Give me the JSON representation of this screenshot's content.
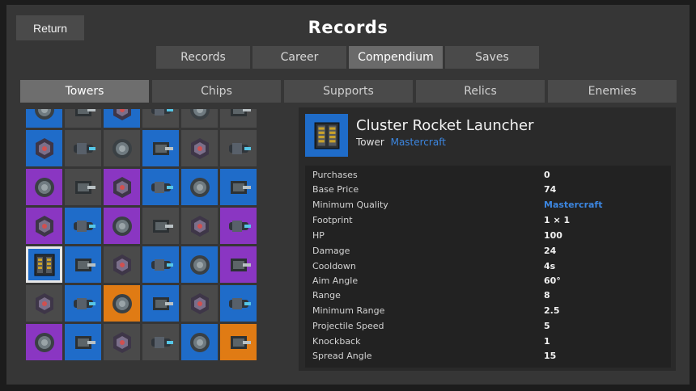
{
  "header": {
    "return_label": "Return",
    "title": "Records"
  },
  "top_tabs": [
    {
      "label": "Records",
      "active": false
    },
    {
      "label": "Career",
      "active": false
    },
    {
      "label": "Compendium",
      "active": true
    },
    {
      "label": "Saves",
      "active": false
    }
  ],
  "category_tabs": [
    {
      "label": "Towers",
      "active": true
    },
    {
      "label": "Chips",
      "active": false
    },
    {
      "label": "Supports",
      "active": false
    },
    {
      "label": "Relics",
      "active": false
    },
    {
      "label": "Enemies",
      "active": false
    }
  ],
  "grid": {
    "cells": [
      {
        "color": "blue",
        "icon": "tower-turret-icon"
      },
      {
        "color": "gray",
        "icon": "tower-turret-icon"
      },
      {
        "color": "blue",
        "icon": "tower-turret-icon"
      },
      {
        "color": "gray",
        "icon": "tower-turret-icon"
      },
      {
        "color": "gray",
        "icon": "tower-turret-icon"
      },
      {
        "color": "gray",
        "icon": "tower-turret-icon"
      },
      {
        "color": "blue",
        "icon": "ring-cannon-icon"
      },
      {
        "color": "gray",
        "icon": "capsule-tower-icon"
      },
      {
        "color": "gray",
        "icon": "long-barrel-icon"
      },
      {
        "color": "blue",
        "icon": "tank-turret-icon"
      },
      {
        "color": "gray",
        "icon": "octagon-gear-icon"
      },
      {
        "color": "gray",
        "icon": "green-launcher-icon"
      },
      {
        "color": "purple",
        "icon": "crab-turret-icon"
      },
      {
        "color": "gray",
        "icon": "white-orb-icon"
      },
      {
        "color": "purple",
        "icon": "heavy-cannon-icon"
      },
      {
        "color": "blue",
        "icon": "sun-core-icon"
      },
      {
        "color": "blue",
        "icon": "red-laser-icon"
      },
      {
        "color": "blue",
        "icon": "blue-dome-icon"
      },
      {
        "color": "purple",
        "icon": "magenta-core-icon"
      },
      {
        "color": "blue",
        "icon": "twin-barrel-icon"
      },
      {
        "color": "purple",
        "icon": "missile-pod-icon"
      },
      {
        "color": "gray",
        "icon": "octagon-plate-icon"
      },
      {
        "color": "gray",
        "icon": "green-jet-icon"
      },
      {
        "color": "purple",
        "icon": "blue-beetle-icon"
      },
      {
        "color": "blue",
        "icon": "cluster-rocket-launcher-icon",
        "selected": true
      },
      {
        "color": "blue",
        "icon": "drill-tower-icon"
      },
      {
        "color": "gray",
        "icon": "box-turret-icon"
      },
      {
        "color": "blue",
        "icon": "rail-gun-icon"
      },
      {
        "color": "blue",
        "icon": "cross-core-icon"
      },
      {
        "color": "purple",
        "icon": "star-ring-icon"
      },
      {
        "color": "gray",
        "icon": "armored-tank-icon"
      },
      {
        "color": "blue",
        "icon": "emerald-core-icon"
      },
      {
        "color": "orange",
        "icon": "violet-core-icon"
      },
      {
        "color": "blue",
        "icon": "red-mech-icon"
      },
      {
        "color": "gray",
        "icon": "small-block-icon"
      },
      {
        "color": "blue",
        "icon": "orange-turret-icon"
      },
      {
        "color": "purple",
        "icon": "cannon-sled-icon"
      },
      {
        "color": "blue",
        "icon": "cargo-tower-icon"
      },
      {
        "color": "gray",
        "icon": "column-tower-icon"
      },
      {
        "color": "gray",
        "icon": "green-gun-icon"
      },
      {
        "color": "blue",
        "icon": "red-sphere-icon"
      },
      {
        "color": "orange",
        "icon": "stone-octagon-icon"
      }
    ]
  },
  "detail": {
    "icon": "cluster-rocket-launcher-icon",
    "name": "Cluster Rocket Launcher",
    "kind": "Tower",
    "quality": "Mastercraft",
    "stats": [
      {
        "label": "Purchases",
        "value": "0"
      },
      {
        "label": "Base Price",
        "value": "74"
      },
      {
        "label": "Minimum Quality",
        "value": "Mastercraft",
        "quality": true
      },
      {
        "label": "Footprint",
        "value": "1 × 1"
      },
      {
        "label": "HP",
        "value": "100"
      },
      {
        "label": "Damage",
        "value": "24"
      },
      {
        "label": "Cooldown",
        "value": "4s"
      },
      {
        "label": "Aim Angle",
        "value": "60°"
      },
      {
        "label": "Range",
        "value": "8"
      },
      {
        "label": "Minimum Range",
        "value": "2.5"
      },
      {
        "label": "Projectile Speed",
        "value": "5"
      },
      {
        "label": "Knockback",
        "value": "1"
      },
      {
        "label": "Spread Angle",
        "value": "15"
      }
    ]
  },
  "colors": {
    "blue": "#1f6cc9",
    "purple": "#8a36c2",
    "orange": "#e07b14",
    "gray": "#4a4a4a",
    "quality_text": "#3c86e0"
  }
}
